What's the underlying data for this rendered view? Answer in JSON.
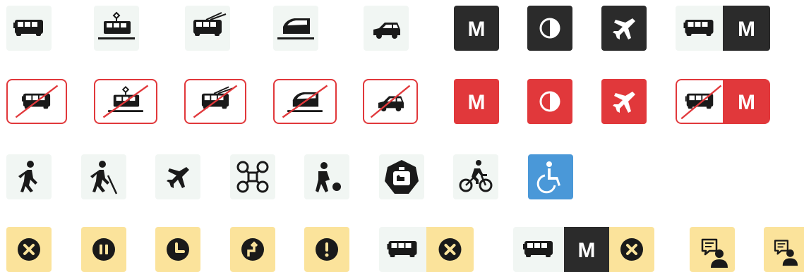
{
  "rows": [
    {
      "name": "transport-normal",
      "items": [
        "bus",
        "tram",
        "trolleybus",
        "train",
        "car",
        "metro",
        "night",
        "airplane",
        "bus-metro"
      ]
    },
    {
      "name": "transport-disrupted",
      "items": [
        "bus",
        "tram",
        "trolleybus",
        "train",
        "car",
        "metro",
        "night",
        "airplane",
        "bus-metro"
      ]
    },
    {
      "name": "travel-modes",
      "items": [
        "walk",
        "hiking",
        "airplane",
        "drone",
        "bowling",
        "pet-carrier",
        "bicycle",
        "wheelchair"
      ]
    },
    {
      "name": "status",
      "items": [
        "cancelled",
        "paused",
        "delayed",
        "detour",
        "warning",
        "bus-cancelled",
        "bus-metro-cancelled",
        "feedback",
        "feedback"
      ]
    }
  ],
  "labels": {
    "metro_letter": "M"
  },
  "colors": {
    "tile_light": "#f1f6f3",
    "tile_dark": "#2b2b2b",
    "alert_red": "#e1383b",
    "accessible_blue": "#4a98d8",
    "status_yellow": "#fbe39b",
    "icon_black": "#1a1a1a"
  }
}
